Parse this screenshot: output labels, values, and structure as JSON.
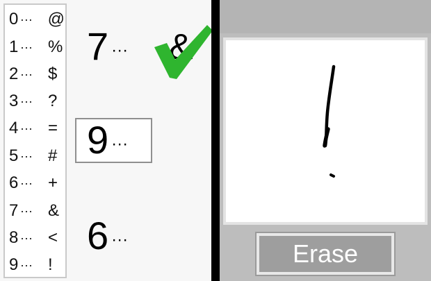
{
  "key": [
    {
      "digit": "0",
      "dots": "···",
      "symbol": "@"
    },
    {
      "digit": "1",
      "dots": "···",
      "symbol": "%"
    },
    {
      "digit": "2",
      "dots": "···",
      "symbol": "$"
    },
    {
      "digit": "3",
      "dots": "···",
      "symbol": "?"
    },
    {
      "digit": "4",
      "dots": "···",
      "symbol": "="
    },
    {
      "digit": "5",
      "dots": "···",
      "symbol": "#"
    },
    {
      "digit": "6",
      "dots": "···",
      "symbol": "+"
    },
    {
      "digit": "7",
      "dots": "···",
      "symbol": "&"
    },
    {
      "digit": "8",
      "dots": "···",
      "symbol": "<"
    },
    {
      "digit": "9",
      "dots": "···",
      "symbol": "!"
    }
  ],
  "clues": [
    {
      "digit": "7",
      "dots": "···",
      "answer": "&",
      "status": "correct"
    },
    {
      "digit": "9",
      "dots": "···",
      "answer": "",
      "status": "active"
    },
    {
      "digit": "6",
      "dots": "···",
      "answer": "",
      "status": "pending"
    }
  ],
  "drawing": {
    "ink_color": "#000000",
    "icon": "handwritten-exclamation"
  },
  "erase_button": {
    "label": "Erase"
  },
  "colors": {
    "check": "#2fb52f",
    "divider": "#000000",
    "button_face": "#9e9e9e"
  }
}
